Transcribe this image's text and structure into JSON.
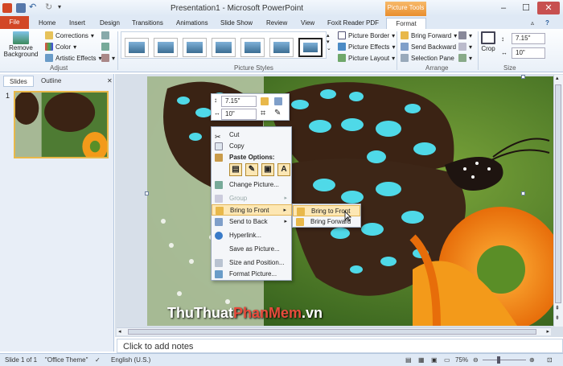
{
  "title_bar": {
    "title": "Presentation1 - Microsoft PowerPoint",
    "context_tool": "Picture Tools"
  },
  "tabs": [
    "File",
    "Home",
    "Insert",
    "Design",
    "Transitions",
    "Animations",
    "Slide Show",
    "Review",
    "View",
    "Foxit Reader PDF",
    "Format"
  ],
  "ribbon": {
    "remove_background": "Remove Background",
    "corrections": "Corrections",
    "color": "Color",
    "artistic_effects": "Artistic Effects",
    "adjust_label": "Adjust",
    "picture_styles_label": "Picture Styles",
    "picture_border": "Picture Border",
    "picture_effects": "Picture Effects",
    "picture_layout": "Picture Layout",
    "bring_forward": "Bring Forward",
    "send_backward": "Send Backward",
    "selection_pane": "Selection Pane",
    "arrange_label": "Arrange",
    "crop": "Crop",
    "height": "7.15\"",
    "width": "10\"",
    "size_label": "Size"
  },
  "left_pane": {
    "tabs": [
      "Slides",
      "Outline"
    ],
    "slide_number": "1"
  },
  "mini_toolbar": {
    "height": "7.15\"",
    "width": "10\""
  },
  "context_menu": {
    "cut": "Cut",
    "copy": "Copy",
    "paste_options": "Paste Options:",
    "change_picture": "Change Picture...",
    "group": "Group",
    "bring_to_front": "Bring to Front",
    "send_to_back": "Send to Back",
    "hyperlink": "Hyperlink...",
    "save_as_picture": "Save as Picture...",
    "size_and_position": "Size and Position...",
    "format_picture": "Format Picture..."
  },
  "submenu": {
    "bring_to_front": "Bring to Front",
    "bring_forward": "Bring Forward"
  },
  "watermark": {
    "part1": "ThuThuat",
    "part2": "PhanMem",
    "part3": ".vn"
  },
  "notes": {
    "placeholder": "Click to add notes"
  },
  "status_bar": {
    "slide_info": "Slide 1 of 1",
    "theme": "\"Office Theme\"",
    "language": "English (U.S.)",
    "zoom": "75%"
  },
  "colors": {
    "accent": "#d24726",
    "context_orange": "#e98e2d",
    "menu_highlight": "#fde7b3"
  }
}
